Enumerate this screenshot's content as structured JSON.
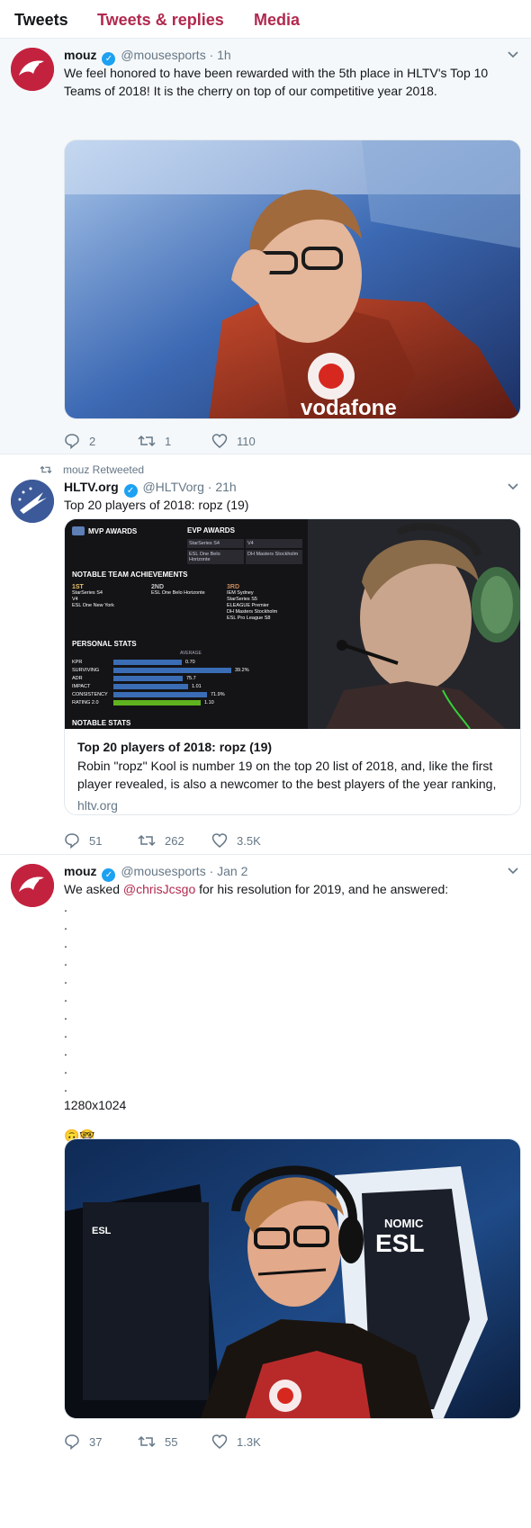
{
  "tabs": [
    {
      "label": "Tweets"
    },
    {
      "label": "Tweets & replies"
    },
    {
      "label": "Media"
    }
  ],
  "colors": {
    "accent": "#b1294e",
    "verified": "#1da1f2",
    "muted": "#657786"
  },
  "tweets": [
    {
      "name": "mouz",
      "handle": "@mousesports",
      "time": "· 1h",
      "text": "We feel honored to have been rewarded with the 5th place  in HLTV's Top 10 Teams of 2018! It is the cherry on top of our competitive year 2018.",
      "replies": "2",
      "retweets": "1",
      "likes": "110",
      "image_brand": "vodafone"
    },
    {
      "retweet_label": "mouz Retweeted",
      "name": "HLTV.org",
      "handle": "@HLTVorg",
      "time": "· 21h",
      "text": "Top 20 players of 2018: ropz (19)",
      "card": {
        "title": "Top 20 players of 2018: ropz (19)",
        "description": "Robin \"ropz\" Kool is number 19 on the top 20 list of 2018, and, like the first player revealed, is also a newcomer to the best players of the year ranking,",
        "domain": "hltv.org",
        "graphic": {
          "mvp_title": "MVP AWARDS",
          "evp_title": "EVP AWARDS",
          "evp_items": [
            "StarSeries S4",
            "V4",
            "ESL One Belo Horizonte",
            "DH Masters Stockholm"
          ],
          "achievements_title": "NOTABLE TEAM ACHIEVEMENTS",
          "place1": "1ST",
          "place1_events": [
            "StarSeries S4",
            "V4",
            "ESL One New York"
          ],
          "place2": "2ND",
          "place2_events": [
            "ESL One Belo Horizonte"
          ],
          "place3": "3RD",
          "place3_events": [
            "IEM Sydney",
            "StarSeries S5",
            "ELEAGUE Premier",
            "DH Masters Stockholm",
            "ESL Pro League S8"
          ],
          "stats_title": "PERSONAL STATS",
          "average_label": "AVERAGE",
          "notable_stats_title": "NOTABLE STATS",
          "stats": [
            {
              "label": "KPR",
              "value": "0.70",
              "fraction": 0.42
            },
            {
              "label": "SURVIVING",
              "value": "39.2%",
              "fraction": 0.73
            },
            {
              "label": "ADR",
              "value": "75.7",
              "fraction": 0.43
            },
            {
              "label": "IMPACT",
              "value": "1.01",
              "fraction": 0.46
            },
            {
              "label": "CONSISTENCY",
              "value": "71.9%",
              "fraction": 0.58
            },
            {
              "label": "RATING 2.0",
              "value": "1.10",
              "fraction": 0.54
            }
          ]
        }
      },
      "replies": "51",
      "retweets": "262",
      "likes": "3.5K"
    },
    {
      "name": "mouz",
      "handle": "@mousesports",
      "time": "· Jan 2",
      "text_before": "We asked ",
      "mention": "@chrisJcsgo",
      "text_after": " for his resolution for 2019, and he answered:",
      "dots": [
        ".",
        ".",
        ".",
        ".",
        ".",
        ".",
        ".",
        ".",
        ".",
        ".",
        "."
      ],
      "resolution": "1280x1024",
      "emojis": "🙃🤓",
      "replies": "37",
      "retweets": "55",
      "likes": "1.3K",
      "image_brands": {
        "esl": "ESL",
        "nomic": "NOMIC",
        "esl_big": "ESL"
      }
    }
  ]
}
